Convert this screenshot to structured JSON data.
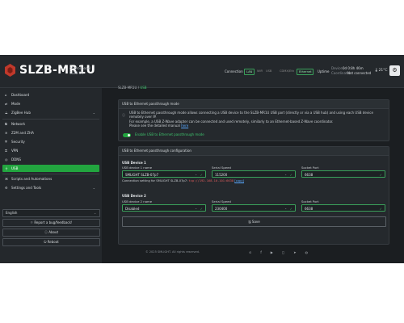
{
  "header": {
    "brand": "SLZB-MR1U",
    "sub1": "control panel",
    "sub2": "SLZB OS",
    "connection_label": "Connection",
    "conn_lan": "LAN",
    "conn_wifi": "WiFi",
    "conn_usb": "USB",
    "conn_cdmx": "CDMX/Eth",
    "conn_ethernet": "Ethernet",
    "uptime_label": "Uptime",
    "device_label": "Device:",
    "device_value": "0d 0:8h 46m",
    "coord_label": "Coordinator:",
    "coord_value": "Not connected",
    "temp": "21°C"
  },
  "sidebar": {
    "items": [
      {
        "label": "Dashboard",
        "icon": "home-icon"
      },
      {
        "label": "Mode",
        "icon": "swap-icon"
      },
      {
        "label": "ZigBee Hub",
        "icon": "zigbee-icon"
      },
      {
        "label": "Network",
        "icon": "network-icon"
      },
      {
        "label": "Z2M and ZHA",
        "icon": "layers-icon"
      },
      {
        "label": "Security",
        "icon": "shield-icon"
      },
      {
        "label": "VPN",
        "icon": "vpn-icon"
      },
      {
        "label": "DDNS",
        "icon": "globe-icon"
      },
      {
        "label": "USB",
        "icon": "usb-icon"
      },
      {
        "label": "Scripts and Automations",
        "icon": "script-icon"
      },
      {
        "label": "Settings and Tools",
        "icon": "gear-icon"
      }
    ],
    "language": "English",
    "report_btn": "Report a bug/feedback!",
    "about_btn": "About",
    "reboot_btn": "Reboot"
  },
  "breadcrumb": {
    "root": "SLZB-MR1U",
    "sep": "/",
    "current": "USB"
  },
  "mode_card": {
    "title": "USB to Ethernet passthrough mode",
    "desc1": "USB to Ethernet passthrough mode allows connecting a USB device to the SLZB-MR1U USB port (directly or via a USB hub) and using each USB device remotely over IP.",
    "desc2": "For example, a USB Z-Wave adapter can be connected and used remotely, similarly to an Ethernet-based Z-Wave coordinator.",
    "desc3_prefix": "Please see the detailed manual",
    "desc3_link": "here",
    "toggle_label": "Enable USB to Ethernet passthrough mode",
    "toggle_on": true
  },
  "config_card": {
    "title": "USB to Ethernet passthrough configuration",
    "device1": {
      "heading": "USB Device 1",
      "name_label": "USB device 1 name",
      "name_value": "SMLIGHT SLZB-07p7",
      "speed_label": "Serial Speed",
      "speed_value": "115200",
      "port_label": "Socket Port",
      "port_value": "6638",
      "conn_prefix": "Connection setting for SMLIGHT SLZB-07p7:",
      "conn_value": "tcp://192.168.10.101:6638",
      "conn_copy": "[copy]"
    },
    "device2": {
      "heading": "USB Device 2",
      "name_label": "USB device 2 name",
      "name_value": "Disabled",
      "speed_label": "Serial Speed",
      "speed_value": "230400",
      "port_label": "Socket Port",
      "port_value": "6638"
    },
    "save": "Save"
  },
  "footer": {
    "copyright": "© 2025 SMLIGHT. All rights reserved."
  },
  "colors": {
    "accent": "#22a53f",
    "background": "#1b1e21",
    "panel": "#25292d"
  }
}
